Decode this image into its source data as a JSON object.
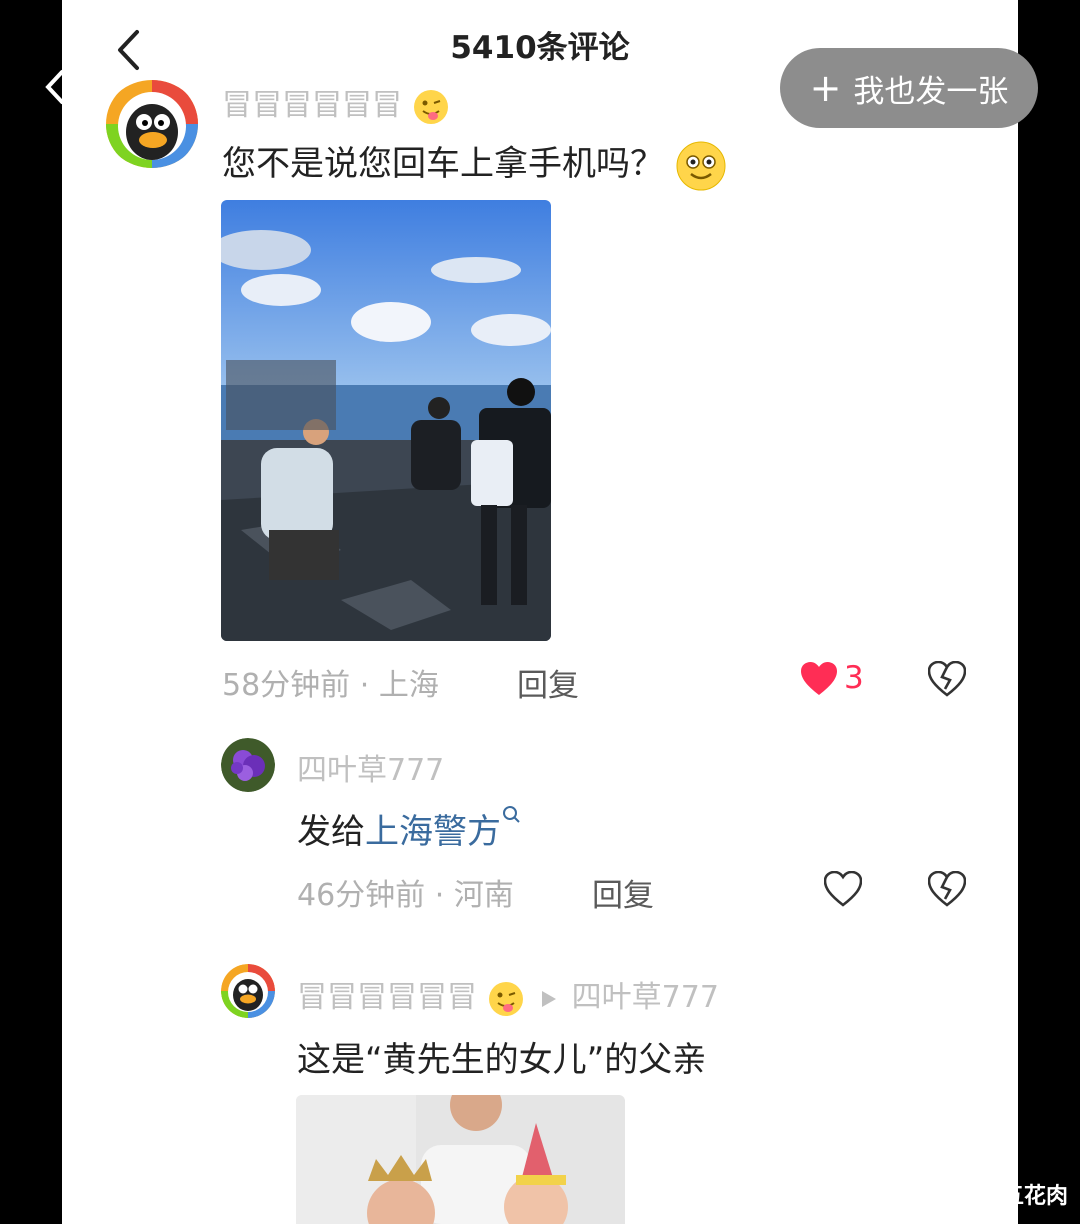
{
  "header": {
    "title": "5410条评论",
    "post_button": "我也发一张"
  },
  "comments": [
    {
      "user": "冒冒冒冒冒冒",
      "text": "您不是说您回车上拿手机吗？",
      "time": "58分钟前",
      "location": "上海",
      "reply_label": "回复",
      "like_count": "3",
      "liked": true
    },
    {
      "user": "四叶草777",
      "text_prefix": "发给",
      "text_link": "上海警方",
      "time": "46分钟前",
      "location": "河南",
      "reply_label": "回复",
      "liked": false
    },
    {
      "user": "冒冒冒冒冒冒",
      "reply_to": "四叶草777",
      "text": "这是“黄先生的女儿”的父亲"
    }
  ],
  "separator": "·",
  "watermark": "不肥不瘦的五花肉",
  "colors": {
    "like_red": "#ff2d55",
    "link_blue": "#3a6b9e",
    "button_gray": "#8d8d8d"
  }
}
